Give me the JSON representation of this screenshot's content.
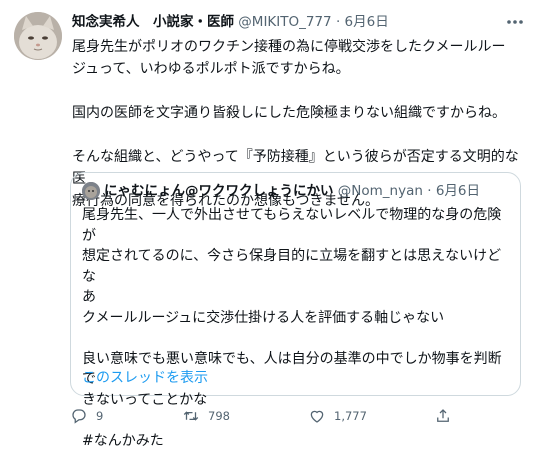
{
  "tweet": {
    "display_name": "知念実希人　小説家・医師",
    "handle": "@MIKITO_777",
    "separator": "·",
    "date": "6月6日",
    "lines": [
      "尾身先生がポリオのワクチン接種の為に停戦交渉をしたクメールルー",
      "ジュって、いわゆるポルポト派ですからね。",
      "",
      "国内の医師を文字通り皆殺しにした危険極まりない組織ですからね。",
      "",
      "そんな組織と、どうやって『予防接種』という彼らが否定する文明的な医",
      "療行為の同意を得られたのか想像もつきません。"
    ]
  },
  "quote": {
    "display_name": "にゃむにょん@ワクワクしょうにかい",
    "handle": "@Nom_nyan",
    "separator": "·",
    "date": "6月6日",
    "lines": [
      "尾身先生、一人で外出させてもらえないレベルで物理的な身の危険が",
      "想定されてるのに、今さら保身目的に立場を翻すとは思えないけどな",
      "あ",
      "クメールルージュに交渉仕掛ける人を評価する軸じゃない",
      "",
      "良い意味でも悪い意味でも、人は自分の基準の中でしか物事を判断で",
      "きないってことかな",
      "",
      "#なんかみた"
    ],
    "show_thread": "このスレッドを表示"
  },
  "actions": {
    "reply_count": "9",
    "retweet_count": "798",
    "like_count": "1,777"
  },
  "icons": {
    "more": "more-horizontal-icon",
    "reply": "reply-icon",
    "retweet": "retweet-icon",
    "like": "heart-icon",
    "share": "share-icon"
  },
  "colors": {
    "text": "#0f1419",
    "secondary": "#536471",
    "link": "#1d9bf0",
    "border": "#cfd9de"
  }
}
